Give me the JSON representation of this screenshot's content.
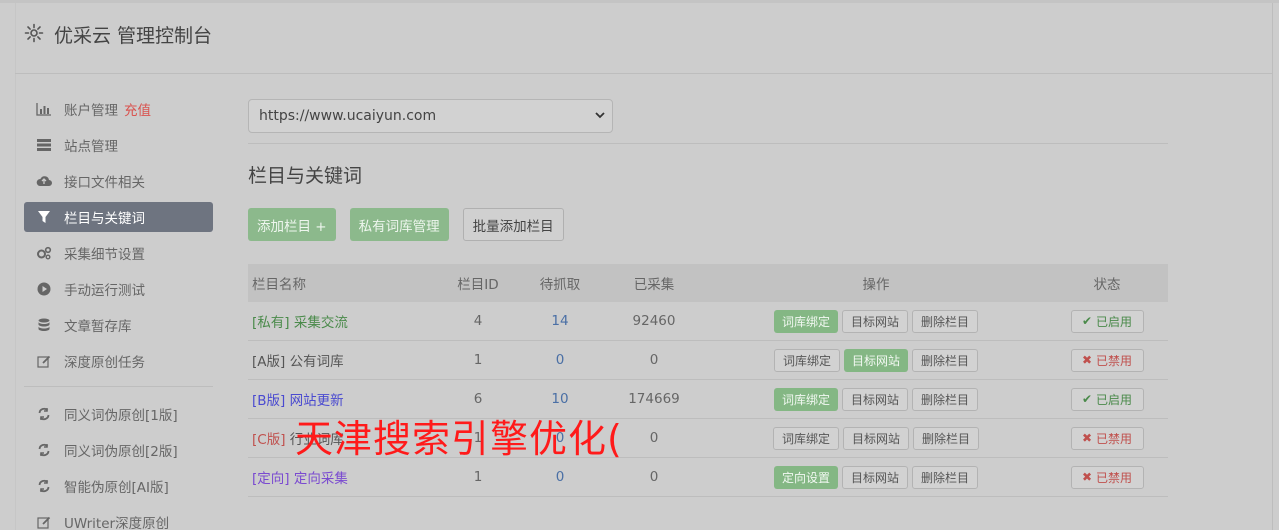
{
  "header": {
    "title": "优采云 管理控制台"
  },
  "sidebar": {
    "items": [
      {
        "label": "账户管理",
        "extra": "充值",
        "icon": "bar-chart-icon"
      },
      {
        "label": "站点管理",
        "icon": "server-icon"
      },
      {
        "label": "接口文件相关",
        "icon": "cloud-upload-icon"
      },
      {
        "label": "栏目与关键词",
        "icon": "filter-icon",
        "active": true
      },
      {
        "label": "采集细节设置",
        "icon": "gears-icon"
      },
      {
        "label": "手动运行测试",
        "icon": "play-circle-icon"
      },
      {
        "label": "文章暂存库",
        "icon": "database-icon"
      },
      {
        "label": "深度原创任务",
        "icon": "edit-icon"
      }
    ],
    "items2": [
      {
        "label": "同义词伪原创[1版]",
        "icon": "refresh-icon"
      },
      {
        "label": "同义词伪原创[2版]",
        "icon": "refresh-icon"
      },
      {
        "label": "智能伪原创[AI版]",
        "icon": "refresh-icon"
      },
      {
        "label": "UWriter深度原创",
        "icon": "edit-icon"
      }
    ]
  },
  "main": {
    "site_select": "https://www.ucaiyun.com",
    "section_title": "栏目与关键词",
    "buttons": {
      "add": "添加栏目 +",
      "private_lib": "私有词库管理",
      "batch_add": "批量添加栏目"
    },
    "table": {
      "headers": {
        "name": "栏目名称",
        "id": "栏目ID",
        "pending": "待抓取",
        "collected": "已采集",
        "ops": "操作",
        "status": "状态"
      },
      "rows": [
        {
          "tag": "[私有]",
          "name": "采集交流",
          "id": "4",
          "pending": "14",
          "collected": "92460",
          "op1": "词库绑定",
          "op2": "目标网站",
          "op3": "删除栏目",
          "status": "已启用"
        },
        {
          "tag": "[A版]",
          "name": "公有词库",
          "id": "1",
          "pending": "0",
          "collected": "0",
          "op1": "词库绑定",
          "op2": "目标网站",
          "op3": "删除栏目",
          "status": "已禁用"
        },
        {
          "tag": "[B版]",
          "name": "网站更新",
          "id": "6",
          "pending": "10",
          "collected": "174669",
          "op1": "词库绑定",
          "op2": "目标网站",
          "op3": "删除栏目",
          "status": "已启用"
        },
        {
          "tag": "[C版]",
          "name": "行业词库",
          "id": "1",
          "pending": "0",
          "collected": "0",
          "op1": "词库绑定",
          "op2": "目标网站",
          "op3": "删除栏目",
          "status": "已禁用"
        },
        {
          "tag": "[定向]",
          "name": "定向采集",
          "id": "1",
          "pending": "0",
          "collected": "0",
          "op1": "定向设置",
          "op2": "目标网站",
          "op3": "删除栏目",
          "status": "已禁用"
        }
      ]
    }
  },
  "watermark": "天津搜索引擎优化(",
  "colors": {
    "accent_green": "#8cb98c",
    "active_nav": "#6e7480",
    "danger": "#c0504d",
    "watermark": "#ff1a1a"
  }
}
